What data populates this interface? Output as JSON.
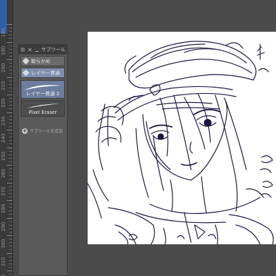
{
  "ruler": {
    "labels": [
      "180",
      "190",
      "200",
      "210",
      "220",
      "230",
      "240",
      "250",
      "260",
      "270",
      "280",
      "290",
      "300",
      "310",
      "320"
    ]
  },
  "subtool_panel": {
    "title": "サブツール",
    "tools": [
      {
        "label": "軟らかめ",
        "icon": "eraser-tip-icon",
        "active": false
      },
      {
        "label": "レイヤー貫通",
        "icon": "eraser-tip-icon",
        "active": true
      }
    ],
    "brushes": [
      {
        "label": "レイヤー貫通 2",
        "icon": "brush-stroke-icon",
        "selected": true
      },
      {
        "label": "Pixel Eraser",
        "icon": "brush-stroke-icon",
        "selected": false
      }
    ],
    "add_label": "サブツールを追加"
  },
  "colors": {
    "ink": "#1a1840",
    "panel": "#5a5a5a",
    "selected": "#7e8fae"
  }
}
